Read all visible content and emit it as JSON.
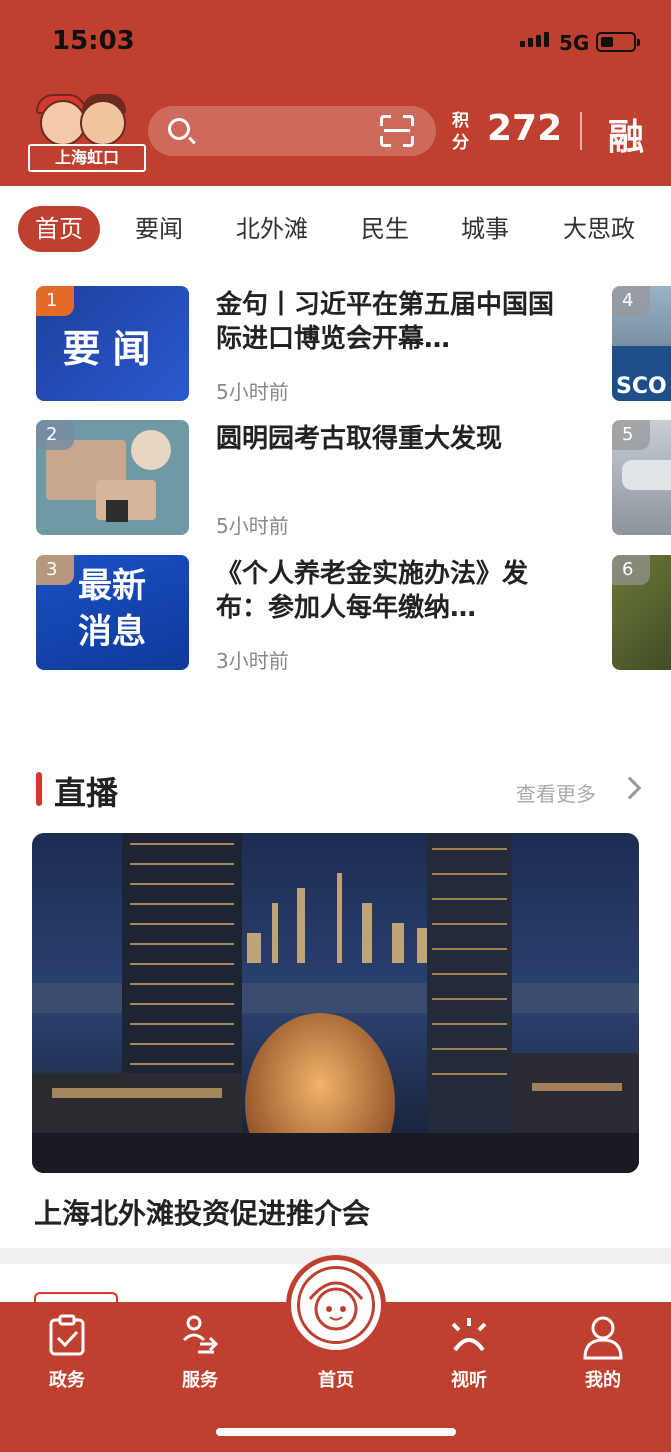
{
  "status": {
    "time": "15:03",
    "network": "5G"
  },
  "header": {
    "logo_text": "上海虹口",
    "points_label": "积分",
    "points_value": "272",
    "rong_label": "融"
  },
  "tabs": [
    "首页",
    "要闻",
    "北外滩",
    "民生",
    "城事",
    "大思政"
  ],
  "news": [
    {
      "rank": "1",
      "title": "金句丨习近平在第五届中国国际进口博览会开幕…",
      "time": "5小时前",
      "thumb_text": "要闻"
    },
    {
      "rank": "2",
      "title": "圆明园考古取得重大发现",
      "time": "5小时前"
    },
    {
      "rank": "3",
      "title": "《个人养老金实施办法》发布：参加人每年缴纳…",
      "time": "3小时前",
      "thumb_text": "最新消息"
    }
  ],
  "peek_ranks": [
    "4",
    "5",
    "6"
  ],
  "peek_text": "SCO",
  "live": {
    "title": "直播",
    "more": "查看更多",
    "caption": "上海北外滩投资促进推介会"
  },
  "tabbar": {
    "items": [
      "政务",
      "服务",
      "首页",
      "视听",
      "我的"
    ]
  },
  "colors": {
    "brand": "#c0402f",
    "accent": "#d8382c"
  }
}
